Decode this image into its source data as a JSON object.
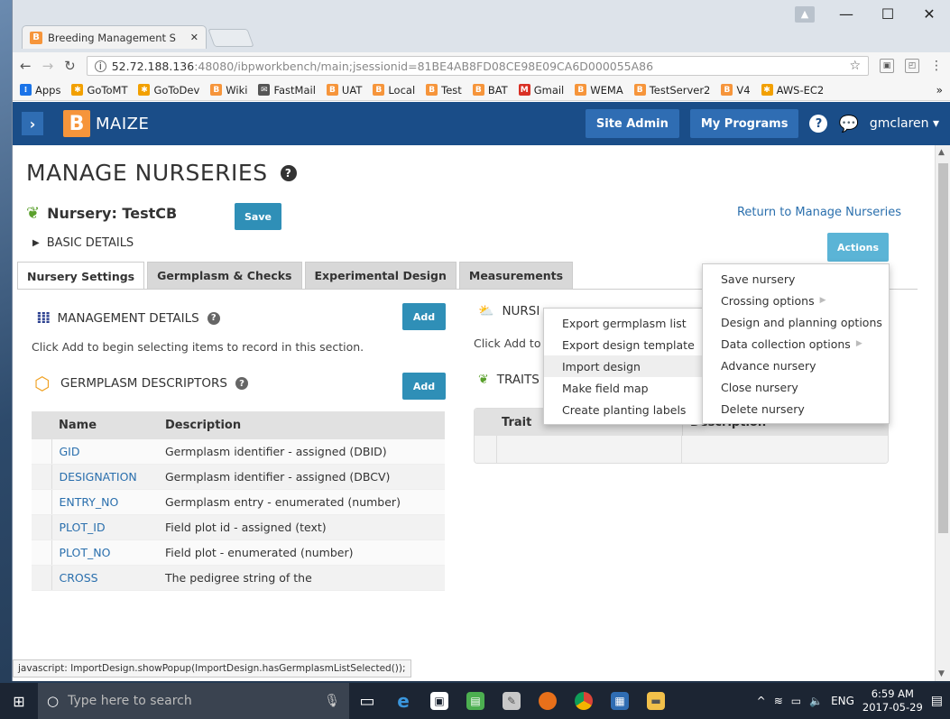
{
  "browser": {
    "tab_title": "Breeding Management S",
    "url_host": "52.72.188.136",
    "url_rest": ":48080/ibpworkbench/main;jsessionid=81BE4AB8FD08CE98E09CA6D000055A86",
    "bookmarks": [
      {
        "label": "Apps",
        "icon": "apps-grid-icon",
        "color": "#1a73e8"
      },
      {
        "label": "GoToMT",
        "icon": "gear-star-icon",
        "color": "#f2a000"
      },
      {
        "label": "GoToDev",
        "icon": "gear-star-icon",
        "color": "#f2a000"
      },
      {
        "label": "Wiki",
        "icon": "b-logo-icon",
        "color": "#f6953b"
      },
      {
        "label": "FastMail",
        "icon": "mail-icon",
        "color": "#555555"
      },
      {
        "label": "UAT",
        "icon": "b-logo-icon",
        "color": "#f6953b"
      },
      {
        "label": "Local",
        "icon": "b-logo-icon",
        "color": "#f6953b"
      },
      {
        "label": "Test",
        "icon": "b-logo-icon",
        "color": "#f6953b"
      },
      {
        "label": "BAT",
        "icon": "b-logo-icon",
        "color": "#f6953b"
      },
      {
        "label": "Gmail",
        "icon": "gmail-icon",
        "color": "#d93025"
      },
      {
        "label": "WEMA",
        "icon": "b-logo-icon",
        "color": "#f6953b"
      },
      {
        "label": "TestServer2",
        "icon": "b-logo-icon",
        "color": "#f6953b"
      },
      {
        "label": "V4",
        "icon": "b-logo-icon",
        "color": "#f6953b"
      },
      {
        "label": "AWS-EC2",
        "icon": "aws-icon",
        "color": "#f2a000"
      }
    ],
    "more": "»"
  },
  "app": {
    "logo_letter": "B",
    "crop": "MAIZE",
    "site_admin": "Site Admin",
    "my_programs": "My Programs",
    "user": "gmclaren",
    "header_color": "#1a4d88"
  },
  "page": {
    "title": "MANAGE NURSERIES",
    "nursery_label": "Nursery: TestCB",
    "save": "Save",
    "return_link": "Return to Manage Nurseries",
    "basic_details": "BASIC DETAILS",
    "actions": "Actions",
    "tabs": [
      "Nursery Settings",
      "Germplasm & Checks",
      "Experimental Design",
      "Measurements"
    ],
    "management_details": "MANAGEMENT DETAILS",
    "add": "Add",
    "hint": "Click Add to begin selecting items to record in this section.",
    "germplasm_descriptors": "GERMPLASM DESCRIPTORS",
    "nursery_conditions": "NURSI",
    "hint_short": "Click Add to",
    "traits": "TRAITS",
    "table_headers": [
      "Name",
      "Description"
    ],
    "rows": [
      {
        "name": "GID",
        "desc": "Germplasm identifier - assigned (DBID)"
      },
      {
        "name": "DESIGNATION",
        "desc": "Germplasm identifier - assigned (DBCV)"
      },
      {
        "name": "ENTRY_NO",
        "desc": "Germplasm entry - enumerated (number)"
      },
      {
        "name": "PLOT_ID",
        "desc": "Field plot id - assigned (text)"
      },
      {
        "name": "PLOT_NO",
        "desc": "Field plot - enumerated (number)"
      },
      {
        "name": "CROSS",
        "desc": "The pedigree string of the"
      }
    ],
    "trait_headers": [
      "Trait",
      "Description"
    ]
  },
  "menus": {
    "design_menu": [
      "Export germplasm list",
      "Export design template",
      "Import design",
      "Make field map",
      "Create planting labels"
    ],
    "actions_menu": [
      "Save nursery",
      "Crossing options",
      "Design and planning options",
      "Data collection options",
      "Advance nursery",
      "Close nursery",
      "Delete nursery"
    ]
  },
  "status_text": "javascript: ImportDesign.showPopup(ImportDesign.hasGermplasmListSelected());",
  "taskbar": {
    "search_placeholder": "Type here to search",
    "lang": "ENG",
    "time": "6:59 AM",
    "date": "2017-05-29"
  }
}
